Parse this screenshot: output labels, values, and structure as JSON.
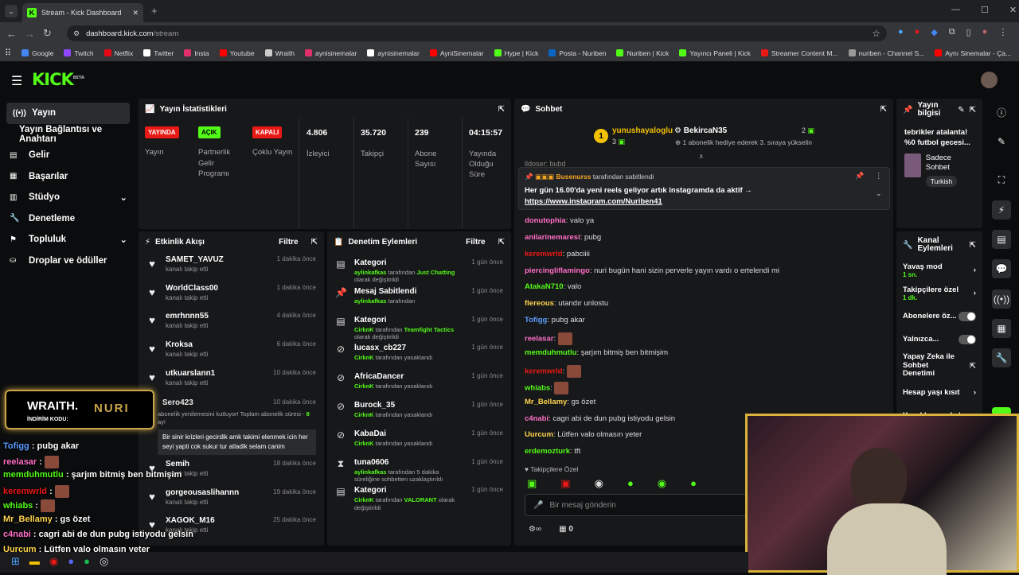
{
  "browser": {
    "tab_title": "Stream - Kick Dashboard",
    "url_host": "dashboard.kick.com",
    "url_path": "/stream",
    "bookmarks": [
      {
        "label": "Google",
        "color": "#4285f4"
      },
      {
        "label": "Twitch",
        "color": "#9146ff"
      },
      {
        "label": "Netflix",
        "color": "#e50914"
      },
      {
        "label": "Twitter",
        "color": "#ffffff"
      },
      {
        "label": "Insta",
        "color": "#e1306c"
      },
      {
        "label": "Youtube",
        "color": "#ff0000"
      },
      {
        "label": "Wraith",
        "color": "#cccccc"
      },
      {
        "label": "aynisinemalar",
        "color": "#e1306c"
      },
      {
        "label": "aynisinemalar",
        "color": "#ffffff"
      },
      {
        "label": "AyniSinemalar",
        "color": "#ff0000"
      },
      {
        "label": "Hype | Kick",
        "color": "#53fc18"
      },
      {
        "label": "Posta - Nuriben",
        "color": "#0a66c2"
      },
      {
        "label": "Nuriben | Kick",
        "color": "#53fc18"
      },
      {
        "label": "Yayıncı Paneli | Kick",
        "color": "#53fc18"
      },
      {
        "label": "Streamer Content M...",
        "color": "#e91916"
      },
      {
        "label": "nuriben - Channel S...",
        "color": "#999999"
      },
      {
        "label": "Aynı Sinemalar - Ça...",
        "color": "#ff0000"
      }
    ]
  },
  "brand": {
    "logo": "KICK",
    "beta": "BETA",
    "accent": "#53fc18"
  },
  "sidebar": [
    {
      "label": "Yayın",
      "icon": "broadcast-icon"
    },
    {
      "label": "Yayın Bağlantısı ve Anahtarı",
      "icon": ""
    },
    {
      "label": "Gelir",
      "icon": "revenue-icon"
    },
    {
      "label": "Başarılar",
      "icon": "achievements-icon"
    },
    {
      "label": "Stüdyo",
      "icon": "studio-icon"
    },
    {
      "label": "Denetleme",
      "icon": "moderation-icon"
    },
    {
      "label": "Topluluk",
      "icon": "community-icon"
    },
    {
      "label": "Droplar ve ödüller",
      "icon": "drops-icon"
    }
  ],
  "stats": {
    "title": "Yayın İstatistikleri",
    "yayin_tag": "YAYINDA",
    "yayin_label": "Yayın",
    "partner_tag": "AÇIK",
    "partner_label": "Partnerlik Gelir Programı",
    "multi_tag": "KAPALI",
    "multi_label": "Çoklu Yayın",
    "viewers": "4.806",
    "viewers_label": "İzleyici",
    "followers": "35.720",
    "followers_label": "Takipçi",
    "subs": "239",
    "subs_label": "Abone Sayısı",
    "uptime": "04:15:57",
    "uptime_label": "Yayında Olduğu Süre"
  },
  "activity": {
    "title": "Etkinlik Akışı",
    "filter": "Filtre",
    "items": [
      {
        "name": "SAMET_YAVUZ",
        "sub": "kanalı takip etti",
        "time": "1 dakika önce"
      },
      {
        "name": "WorldClass00",
        "sub": "kanalı takip etti",
        "time": "1 dakika önce"
      },
      {
        "name": "emrhnnn55",
        "sub": "kanalı takip etti",
        "time": "4 dakika önce"
      },
      {
        "name": "Kroksa",
        "sub": "kanalı takip etti",
        "time": "6 dakika önce"
      },
      {
        "name": "utkuarslann1",
        "sub": "kanalı takip etti",
        "time": "10 dakika önce"
      }
    ],
    "sub_event": {
      "name": "Sero423",
      "time": "10 dakika önce",
      "text": "abonelik yenilemesini kutluyor! Toplam abonelik süresi -",
      "months": "8",
      "months_suffix": "ay!",
      "message": "Bir sinir krizleri gecirdik amk takimi elenmek icin her seyi yapti cok sukur tur atladik selam canim"
    },
    "items2": [
      {
        "name": "Semih",
        "sub": "kanalı takip etti",
        "time": "18 dakika önce"
      },
      {
        "name": "gorgeousaslihannn",
        "sub": "kanalı takip etti",
        "time": "19 dakika önce"
      },
      {
        "name": "XAGOK_M16",
        "sub": "kanalı takip etti",
        "time": "25 dakika önce"
      }
    ]
  },
  "moderation": {
    "title": "Denetim Eylemleri",
    "filter": "Filtre",
    "items": [
      {
        "icon": "category-icon",
        "glyph": "▤",
        "name": "Kategori",
        "actor": "aylinkafkas",
        "pre": "tarafından",
        "hl": "Just Chatting",
        "post": "olarak değiştirildi",
        "time": "1 gün önce"
      },
      {
        "icon": "pin-icon",
        "glyph": "📌",
        "name": "Mesaj Sabitlendi",
        "actor": "aylinkafkas",
        "pre": "tarafından",
        "hl": "",
        "post": "",
        "time": "1 gün önce"
      },
      {
        "icon": "category-icon",
        "glyph": "▤",
        "name": "Kategori",
        "actor": "CirknK",
        "pre": "tarafından",
        "hl": "Teamfight Tactics",
        "post": "olarak değiştirildi",
        "time": "1 gün önce"
      },
      {
        "icon": "ban-icon",
        "glyph": "⊘",
        "name": "lucasx_cb227",
        "actor": "CirknK",
        "pre": "tarafından yasaklandı",
        "hl": "",
        "post": "",
        "time": "1 gün önce"
      },
      {
        "icon": "ban-icon",
        "glyph": "⊘",
        "name": "AfricaDancer",
        "actor": "CirknK",
        "pre": "tarafından yasaklandı",
        "hl": "",
        "post": "",
        "time": "1 gün önce"
      },
      {
        "icon": "ban-icon",
        "glyph": "⊘",
        "name": "Burock_35",
        "actor": "CirknK",
        "pre": "tarafından yasaklandı",
        "hl": "",
        "post": "",
        "time": "1 gün önce"
      },
      {
        "icon": "ban-icon",
        "glyph": "⊘",
        "name": "KabaDai",
        "actor": "CirknK",
        "pre": "tarafından yasaklandı",
        "hl": "",
        "post": "",
        "time": "1 gün önce"
      },
      {
        "icon": "timeout-icon",
        "glyph": "⧗",
        "name": "tuna0606",
        "actor": "aylinkafkas",
        "pre": "tarafından 5 dakika süreliğine sohbetten uzaklaştırıldı",
        "hl": "",
        "post": "",
        "time": "1 gün önce"
      },
      {
        "icon": "category-icon",
        "glyph": "▤",
        "name": "Kategori",
        "actor": "CirknK",
        "pre": "tarafından",
        "hl": "VALORANT",
        "post": "olarak değiştirildi",
        "time": "1 gün önce"
      }
    ]
  },
  "chat": {
    "title": "Sohbet",
    "gifter": {
      "name": "yunushayaloglu",
      "count": "3",
      "rank": "1"
    },
    "gift_banner": {
      "name": "BekircaN35",
      "count": "2",
      "text": "1 abonelik hediye ederek 3. sıraya yükselin"
    },
    "partial": "lldoser: bubd",
    "pinned": {
      "by": "Busenurss",
      "by_suffix": "tarafından sabitlendi",
      "text": "Her gün 16.00'da yeni reels geliyor artık instagramda da aktif →",
      "link": "https://www.instagram.com/Nuriben41"
    },
    "messages": [
      {
        "user": "donutophia",
        "color": "#ff6ec7",
        "text": "valo ya"
      },
      {
        "user": "anilarinemaresi",
        "color": "#ff6ec7",
        "text": "pubg"
      },
      {
        "user": "keremwrld",
        "color": "#e91916",
        "text": "pabciiii"
      },
      {
        "user": "piercingliflamingo",
        "color": "#ff6ec7",
        "text": "nuri bugün hani sizin perverle yayın vardı o ertelendi mi"
      },
      {
        "user": "AtakaN710",
        "color": "#53fc18",
        "text": "valo"
      },
      {
        "user": "flereous",
        "color": "#ffd54f",
        "text": "utandır unlostu"
      },
      {
        "user": "Tofigg",
        "color": "#5c9dff",
        "text": "pubg akar"
      },
      {
        "user": "reelasar",
        "color": "#ff6ec7",
        "text": ""
      },
      {
        "user": "memduhmutlu",
        "color": "#53fc18",
        "text": "şarjım bitmiş ben bitmişim"
      },
      {
        "user": "keremwrld",
        "color": "#e91916",
        "text": ""
      },
      {
        "user": "whiabs",
        "color": "#53fc18",
        "text": ""
      },
      {
        "user": "Mr_Bellamy",
        "color": "#ffd54f",
        "text": "gs özet"
      },
      {
        "user": "c4nabi",
        "color": "#ff6ec7",
        "text": "cagri abi de dun pubg istiyodu gelsin"
      },
      {
        "user": "Uurcum",
        "color": "#ffd54f",
        "text": "Lütfen valo olmasın yeter"
      },
      {
        "user": "erdemozturk",
        "color": "#53fc18",
        "text": "tft"
      }
    ],
    "followers_only": "Takipçilere Özel",
    "input_placeholder": "Bir mesaj gönderin",
    "bottom_count": "0"
  },
  "stream_info": {
    "title": "Yayın bilgisi",
    "stream_title": "tebrikler atalanta! %0 futbol gecesi...",
    "category": "Sadece Sohbet",
    "language": "Turkish"
  },
  "channel_actions": {
    "title": "Kanal Eylemleri",
    "items": [
      {
        "label": "Yavaş mod",
        "sub": "1 sn.",
        "type": "chevron"
      },
      {
        "label": "Takipçilere özel s...",
        "sub": "1 dk.",
        "type": "chevron"
      },
      {
        "label": "Abonelere öz...",
        "sub": "",
        "type": "toggle"
      },
      {
        "label": "Yalnızca...",
        "sub": "",
        "type": "toggle"
      },
      {
        "label": "Yapay Zeka ile Sohbet Denetimi",
        "sub": "",
        "type": "external"
      },
      {
        "label": "Hesap yaşı kısıtla",
        "sub": "",
        "type": "chevron"
      },
      {
        "label": "Yasaklanmış kelin...",
        "sub": "",
        "type": "chevron"
      }
    ]
  },
  "overlay": {
    "sponsor_name": "WRAITH.",
    "sponsor_code_label": "İNDİRİM KODU:",
    "sponsor_code": "NURI",
    "chat": [
      {
        "user": "Tofigg",
        "text": ": pubg akar",
        "color": "#5c9dff"
      },
      {
        "user": "reelasar",
        "text": ":",
        "color": "#ff6ec7"
      },
      {
        "user": "memduhmutlu",
        "text": ": şarjım bitmiş ben bitmişim",
        "color": "#53fc18"
      },
      {
        "user": "keremwrld",
        "text": ":",
        "color": "#e91916"
      },
      {
        "user": "whiabs",
        "text": ":",
        "color": "#53fc18"
      },
      {
        "user": "Mr_Bellamy",
        "text": ": gs özet",
        "color": "#ffd54f"
      },
      {
        "user": "c4nabi",
        "text": ": cagri abi de dun pubg istiyodu gelsin",
        "color": "#ff6ec7"
      },
      {
        "user": "Uurcum",
        "text": ": Lütfen valo olmasın yeter",
        "color": "#ffd54f"
      },
      {
        "user": "erdemozturk",
        "text": ": tft",
        "color": "#53fc18"
      }
    ]
  }
}
